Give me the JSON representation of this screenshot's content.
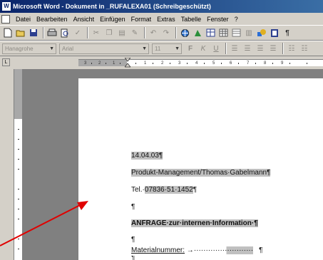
{
  "window": {
    "title": "Microsoft Word - Dokument in _RUFALEXA01 (Schreibgeschützt)",
    "app_icon_glyph": "W"
  },
  "menu": {
    "items": [
      "Datei",
      "Bearbeiten",
      "Ansicht",
      "Einfügen",
      "Format",
      "Extras",
      "Tabelle",
      "Fenster",
      "?"
    ]
  },
  "format_toolbar": {
    "style_value": "Hanagrohe",
    "font_value": "Arial",
    "size_value": "11"
  },
  "ruler": {
    "numbers": [
      "3",
      "2",
      "1",
      "1",
      "2",
      "3",
      "4",
      "5",
      "6",
      "7",
      "8",
      "9"
    ]
  },
  "document": {
    "lines": [
      {
        "text": "14.04.03¶"
      },
      {
        "text": "Produkt-Management/Thomas·Gabelmann¶"
      },
      {
        "prefix": "Tel.·",
        "value": "07836·51·1452",
        "suffix": "¶"
      },
      {
        "text": "¶"
      },
      {
        "text": "ANFRAGE·zur·internen·Information·¶"
      },
      {
        "text": "¶"
      },
      {
        "label": "Materialnummer:",
        "tab": " →",
        "dots": "·························",
        "suffix": "¶"
      },
      {
        "text": "¶"
      }
    ]
  },
  "colors": {
    "title_start": "#0a246a",
    "title_end": "#3a6ea5",
    "chrome": "#d4d0c8",
    "workspace": "#808080",
    "highlight": "#c0c0c0",
    "arrow": "#e00000"
  }
}
